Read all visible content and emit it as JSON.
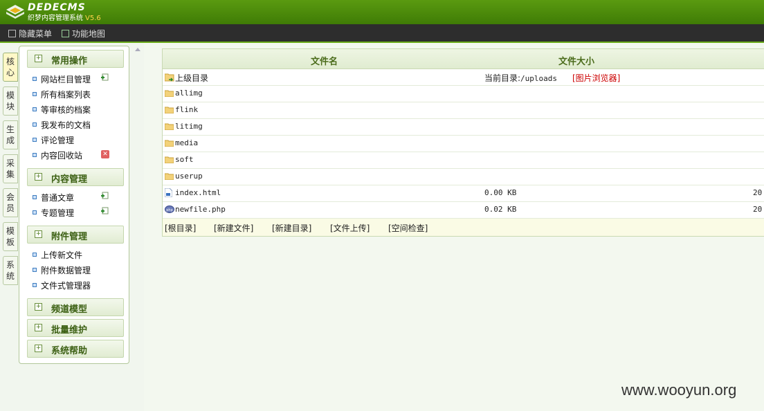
{
  "header": {
    "logo_text": "DEDECMS",
    "logo_subtitle": "织梦内容管理系统",
    "version": "V5.6",
    "brand_color": "#4a8a0c"
  },
  "menubar": {
    "hide_menu": "隐藏菜单",
    "function_map": "功能地图"
  },
  "tabs": [
    {
      "label": "核心",
      "active": true
    },
    {
      "label": "模块"
    },
    {
      "label": "生成"
    },
    {
      "label": "采集"
    },
    {
      "label": "会员"
    },
    {
      "label": "模板"
    },
    {
      "label": "系统"
    }
  ],
  "sidebar": {
    "sections": [
      {
        "title": "常用操作",
        "items": [
          "网站栏目管理",
          "所有档案列表",
          "等审核的档案",
          "我发布的文档",
          "评论管理",
          "内容回收站"
        ]
      },
      {
        "title": "内容管理",
        "items": [
          "普通文章",
          "专题管理"
        ]
      },
      {
        "title": "附件管理",
        "items": [
          "上传新文件",
          "附件数据管理",
          "文件式管理器"
        ]
      },
      {
        "title": "频道模型",
        "items": []
      },
      {
        "title": "批量维护",
        "items": []
      },
      {
        "title": "系统帮助",
        "items": []
      }
    ]
  },
  "file_manager": {
    "col_name": "文件名",
    "col_size": "文件大小",
    "parent_dir": "上级目录",
    "current_dir_label": "当前目录:",
    "current_dir": "/uploads",
    "image_browser": "[图片浏览器]",
    "rows": [
      {
        "name": "allimg",
        "type": "folder",
        "size": "",
        "time": ""
      },
      {
        "name": "flink",
        "type": "folder",
        "size": "",
        "time": ""
      },
      {
        "name": "litimg",
        "type": "folder",
        "size": "",
        "time": ""
      },
      {
        "name": "media",
        "type": "folder",
        "size": "",
        "time": ""
      },
      {
        "name": "soft",
        "type": "folder",
        "size": "",
        "time": ""
      },
      {
        "name": "userup",
        "type": "folder",
        "size": "",
        "time": ""
      },
      {
        "name": "index.html",
        "type": "html",
        "size": "0.00 KB",
        "time": "20"
      },
      {
        "name": "newfile.php",
        "type": "php",
        "size": "0.02 KB",
        "time": "20"
      }
    ],
    "footer_links": [
      "[根目录]",
      "[新建文件]",
      "[新建目录]",
      "[文件上传]",
      "[空间检查]"
    ]
  },
  "watermark": "www.wooyun.org"
}
